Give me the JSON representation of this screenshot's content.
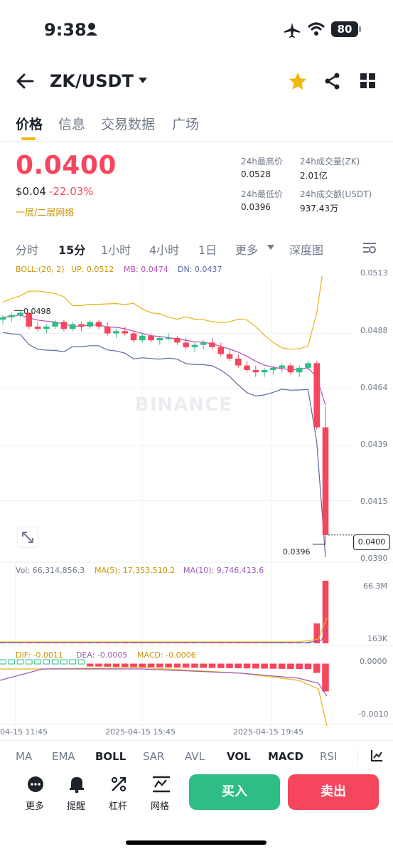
{
  "status_bar": {
    "time": "9:38",
    "battery": "80"
  },
  "header": {
    "pair": "ZK/USDT"
  },
  "tabs": [
    {
      "label": "价格",
      "active": true
    },
    {
      "label": "信息",
      "active": false
    },
    {
      "label": "交易数据",
      "active": false
    },
    {
      "label": "广场",
      "active": false
    }
  ],
  "price": {
    "last": "0.0400",
    "usd": "$0.04",
    "change": "-22.03%",
    "network": "一层/二层网络"
  },
  "stats": {
    "high_label": "24h最高价",
    "high": "0.0528",
    "low_label": "24h最低价",
    "low": "0.0396",
    "vol_label": "24h成交量(ZK)",
    "vol": "2.01亿",
    "turnover_label": "24h成交额(USDT)",
    "turnover": "937.43万"
  },
  "intervals": [
    {
      "label": "分时",
      "active": false
    },
    {
      "label": "15分",
      "active": true
    },
    {
      "label": "1小时",
      "active": false
    },
    {
      "label": "4小时",
      "active": false
    },
    {
      "label": "1日",
      "active": false
    },
    {
      "label": "更多",
      "active": false
    }
  ],
  "depth_label": "深度图",
  "boll": {
    "name": "BOLL:(20, 2)",
    "up": "UP: 0.0512",
    "mb": "MB: 0.0474",
    "dn": "DN: 0.0437"
  },
  "price_axis": [
    "0.0513",
    "0.0488",
    "0.0464",
    "0.0439",
    "0.0415",
    "0.0390"
  ],
  "markers": {
    "high": "0.0498",
    "low": "0.0396",
    "current": "0.0400"
  },
  "watermark": "BINANCE",
  "volume": {
    "vol": "Vol: 66,314,856.3",
    "ma5": "MA(5): 17,353,510.2",
    "ma10": "MA(10): 9,746,413.6",
    "axis_top": "66.3M",
    "axis_bottom": "163K"
  },
  "macd": {
    "dif": "DIF: -0.0011",
    "dea": "DEA: -0.0005",
    "macd": "MACD: -0.0006",
    "axis_top": "0.0000",
    "axis_bottom": "-0.0010"
  },
  "time_axis": [
    "04-15 11:45",
    "2025-04-15 15:45",
    "2025-04-15 19:45"
  ],
  "indicator_tabs": [
    {
      "label": "MA",
      "active": false
    },
    {
      "label": "EMA",
      "active": false
    },
    {
      "label": "BOLL",
      "active": true
    },
    {
      "label": "SAR",
      "active": false
    },
    {
      "label": "AVL",
      "active": false
    },
    {
      "label": "VOL",
      "active": true
    },
    {
      "label": "MACD",
      "active": true
    },
    {
      "label": "RSI",
      "active": false
    }
  ],
  "bottom_nav": {
    "more": "更多",
    "alert": "提醒",
    "leverage": "杠杆",
    "grid": "网格",
    "buy": "买入",
    "sell": "卖出"
  },
  "colors": {
    "up": "#2ebd85",
    "down": "#f6465d",
    "accent": "#f0b90b",
    "ma5": "#e8b416",
    "ma10": "#9b59b6"
  },
  "chart_data": {
    "type": "candlestick",
    "interval": "15m",
    "ylim": [
      0.039,
      0.0513
    ],
    "candles": [
      [
        0.0494,
        0.0496,
        0.0492,
        0.0495
      ],
      [
        0.0495,
        0.0497,
        0.0493,
        0.0496
      ],
      [
        0.0496,
        0.0498,
        0.0495,
        0.0497
      ],
      [
        0.0497,
        0.0497,
        0.049,
        0.0491
      ],
      [
        0.0491,
        0.0493,
        0.0489,
        0.049
      ],
      [
        0.049,
        0.0492,
        0.0488,
        0.0491
      ],
      [
        0.0491,
        0.0494,
        0.049,
        0.0493
      ],
      [
        0.0493,
        0.0494,
        0.0489,
        0.049
      ],
      [
        0.049,
        0.0493,
        0.0489,
        0.0492
      ],
      [
        0.0492,
        0.0493,
        0.0489,
        0.0491
      ],
      [
        0.0491,
        0.0494,
        0.049,
        0.0493
      ],
      [
        0.0493,
        0.0494,
        0.049,
        0.0491
      ],
      [
        0.0491,
        0.0493,
        0.0487,
        0.0488
      ],
      [
        0.0488,
        0.049,
        0.0486,
        0.0489
      ],
      [
        0.0489,
        0.0491,
        0.0487,
        0.0488
      ],
      [
        0.0488,
        0.0489,
        0.0484,
        0.0485
      ],
      [
        0.0485,
        0.0488,
        0.0484,
        0.0487
      ],
      [
        0.0487,
        0.0488,
        0.0484,
        0.0485
      ],
      [
        0.0485,
        0.0487,
        0.0483,
        0.0486
      ],
      [
        0.0486,
        0.0488,
        0.0485,
        0.0486
      ],
      [
        0.0486,
        0.0487,
        0.0483,
        0.0484
      ],
      [
        0.0484,
        0.0486,
        0.0481,
        0.0482
      ],
      [
        0.0482,
        0.0484,
        0.048,
        0.0483
      ],
      [
        0.0483,
        0.0485,
        0.0481,
        0.0484
      ],
      [
        0.0484,
        0.0486,
        0.0481,
        0.0482
      ],
      [
        0.0482,
        0.0484,
        0.0478,
        0.0479
      ],
      [
        0.0479,
        0.0481,
        0.0476,
        0.0477
      ],
      [
        0.0477,
        0.0479,
        0.0473,
        0.0474
      ],
      [
        0.0474,
        0.0476,
        0.0471,
        0.0472
      ],
      [
        0.0472,
        0.0474,
        0.0469,
        0.0471
      ],
      [
        0.0471,
        0.0473,
        0.0469,
        0.0472
      ],
      [
        0.0472,
        0.0474,
        0.047,
        0.0473
      ],
      [
        0.0473,
        0.0475,
        0.0471,
        0.0474
      ],
      [
        0.0474,
        0.0475,
        0.047,
        0.0471
      ],
      [
        0.0471,
        0.0474,
        0.0469,
        0.0473
      ],
      [
        0.0473,
        0.0476,
        0.0472,
        0.0475
      ],
      [
        0.0475,
        0.0476,
        0.0446,
        0.0447
      ],
      [
        0.0447,
        0.0456,
        0.0396,
        0.04
      ]
    ]
  }
}
